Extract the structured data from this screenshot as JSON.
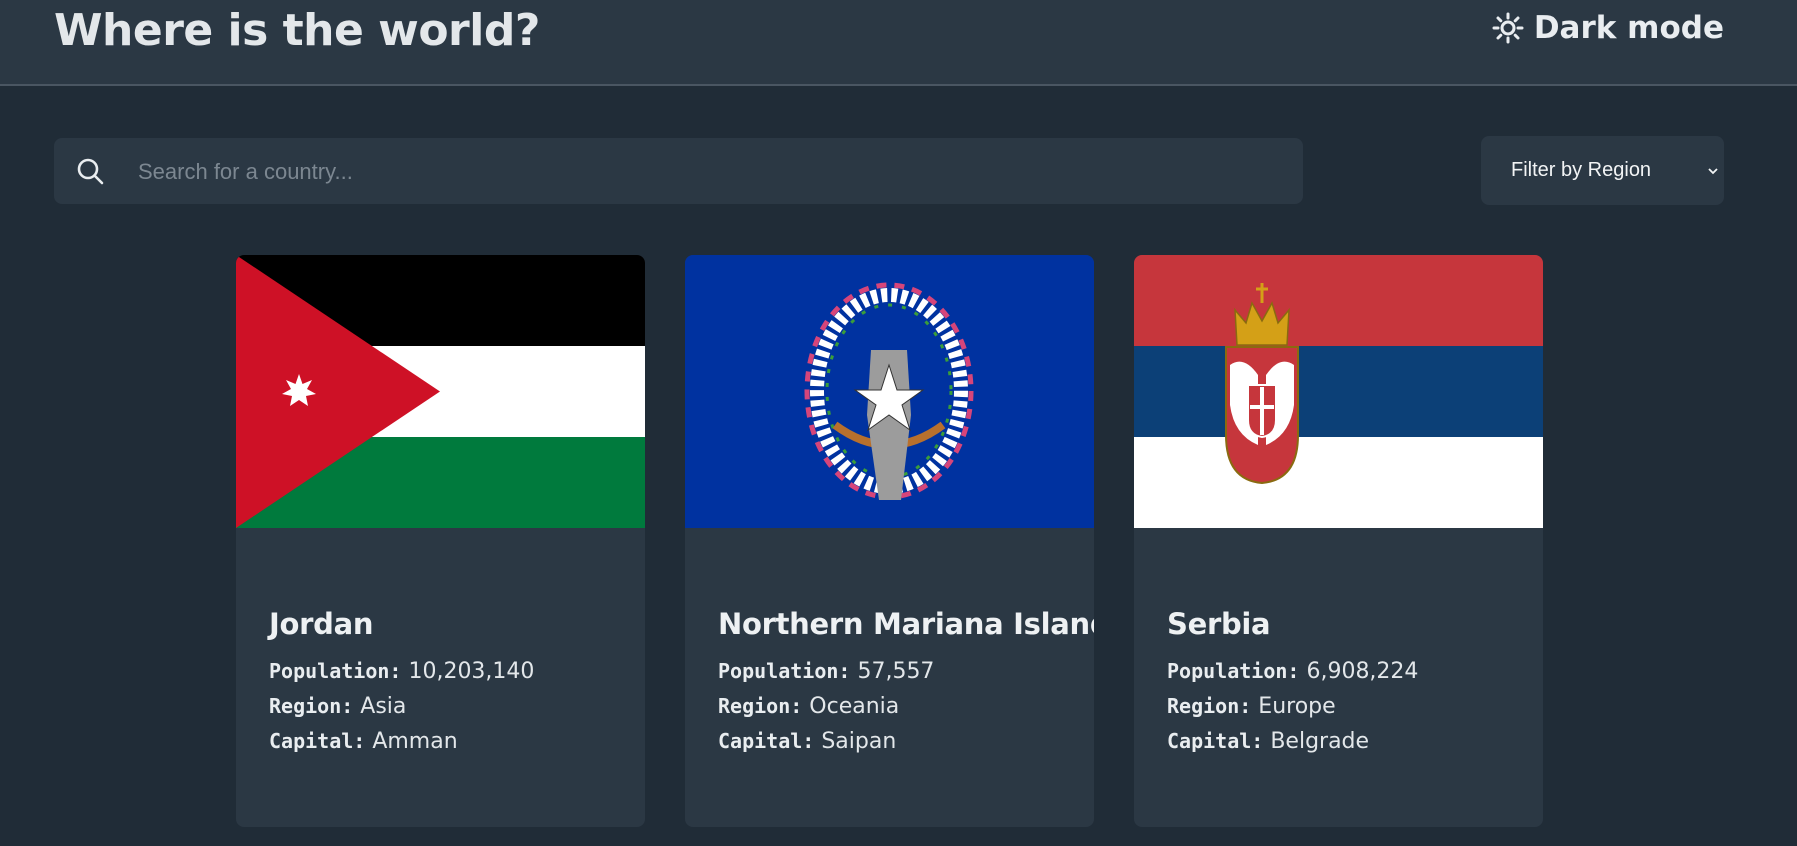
{
  "header": {
    "title": "Where is the world?",
    "mode_toggle": {
      "label": "Dark mode",
      "icon": "sun-icon"
    }
  },
  "search": {
    "placeholder": "Search for a country...",
    "value": "",
    "icon": "search-icon"
  },
  "filter": {
    "selected": "Filter by Region",
    "icon": "chevron-down-icon"
  },
  "labels": {
    "population": "Population:",
    "region": "Region:",
    "capital": "Capital:"
  },
  "countries": [
    {
      "name": "Jordan",
      "population": "10,203,140",
      "region": "Asia",
      "capital": "Amman",
      "flag": "jordan-flag"
    },
    {
      "name": "Northern Mariana Islands",
      "population": "57,557",
      "region": "Oceania",
      "capital": "Saipan",
      "flag": "northern-mariana-islands-flag"
    },
    {
      "name": "Serbia",
      "population": "6,908,224",
      "region": "Europe",
      "capital": "Belgrade",
      "flag": "serbia-flag"
    }
  ],
  "colors": {
    "background": "#202c37",
    "surface": "#2b3844",
    "text": "#e9edf0"
  }
}
